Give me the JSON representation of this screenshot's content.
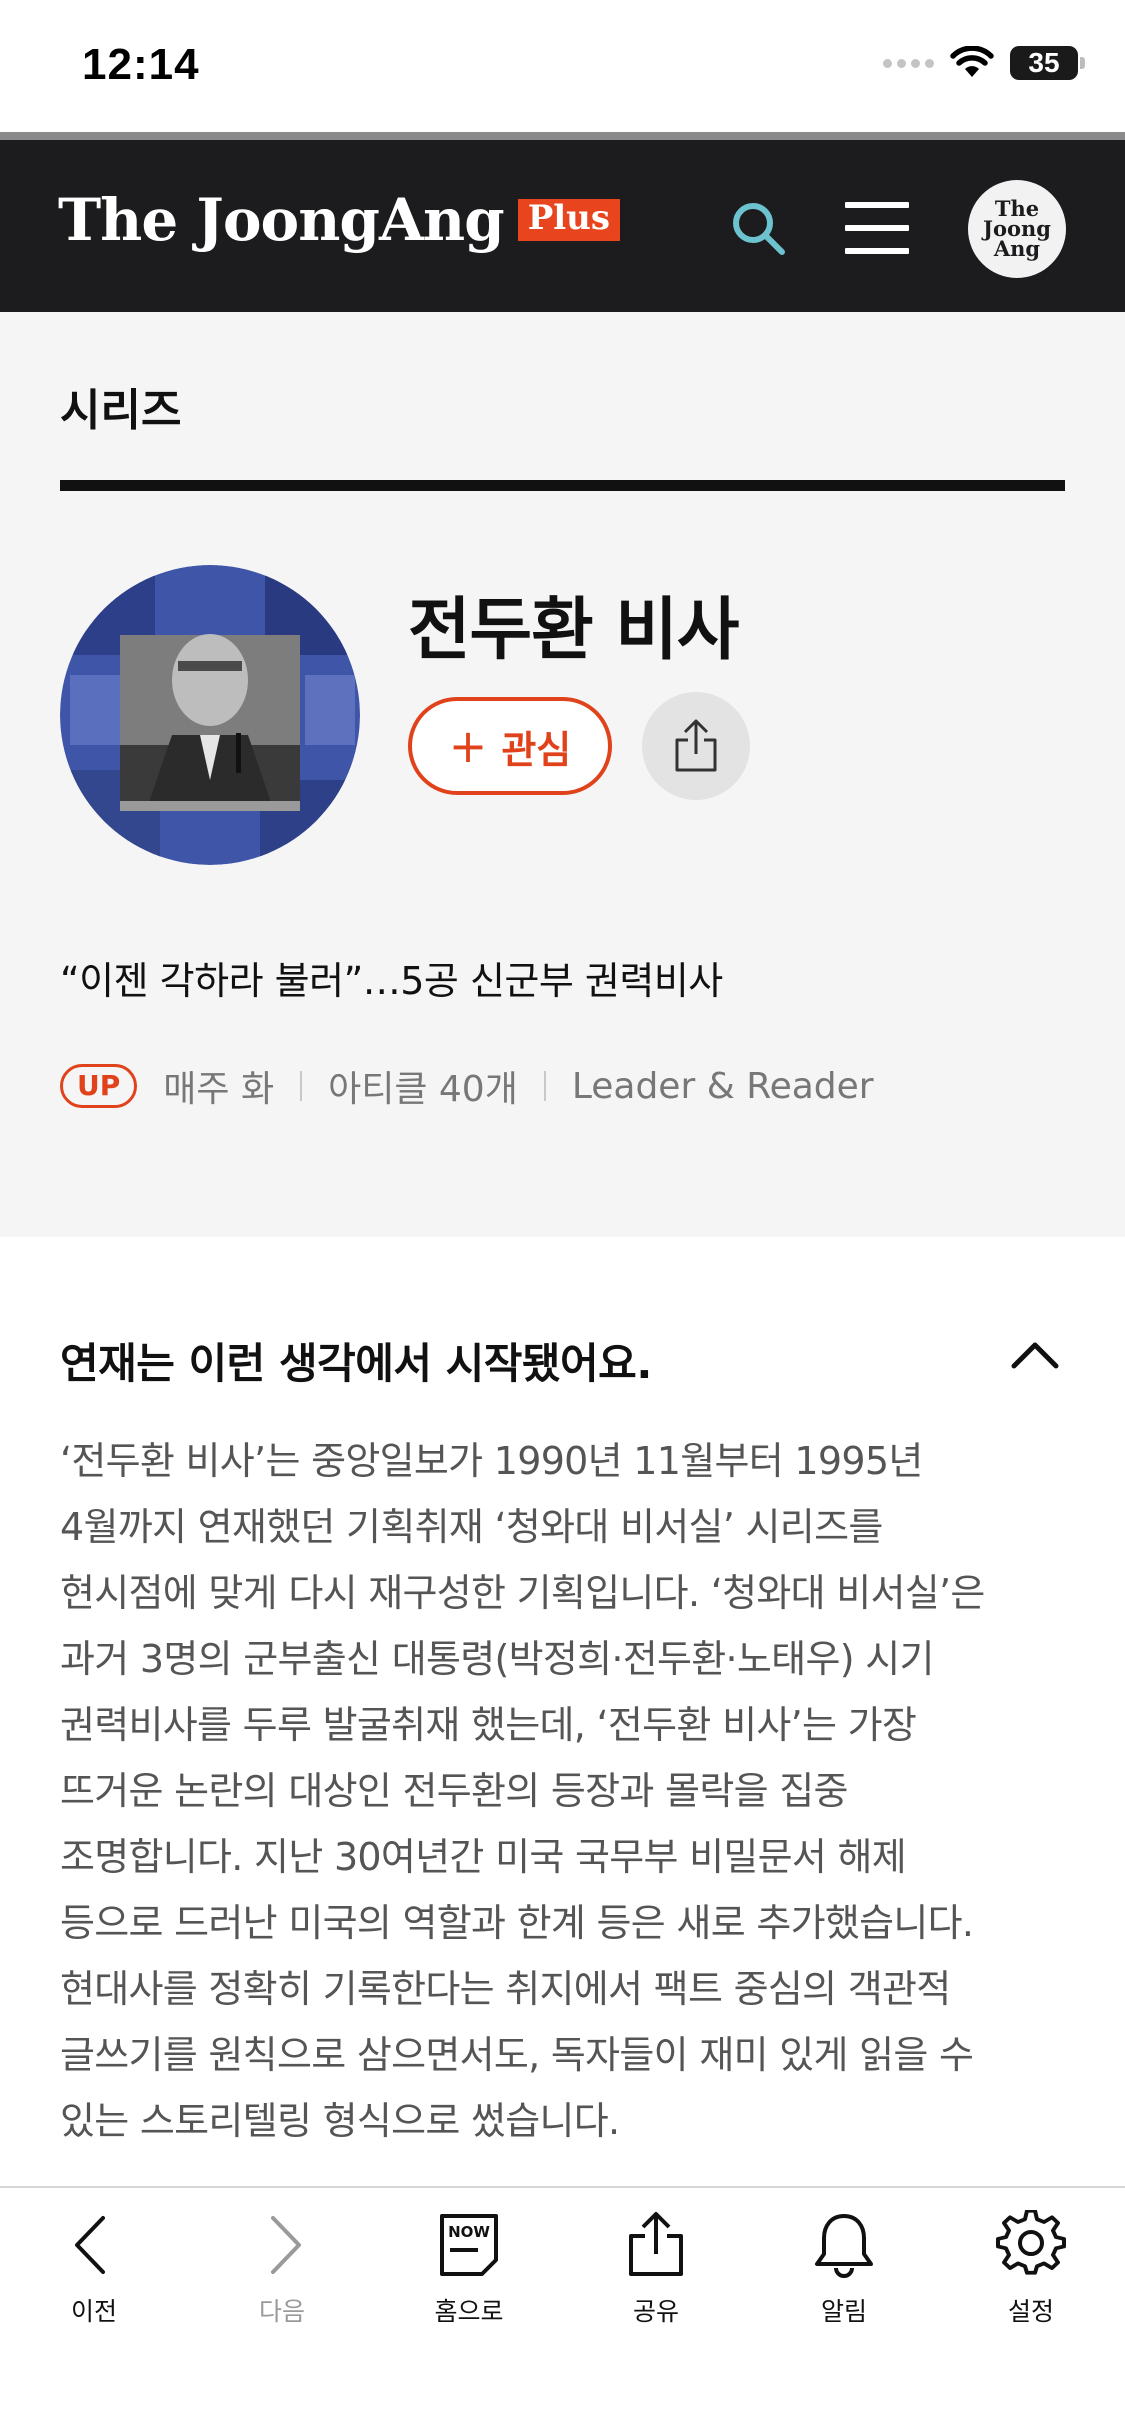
{
  "status_bar": {
    "time": "12:14",
    "battery": "35"
  },
  "header": {
    "logo": "The JoongAng",
    "logo_badge": "Plus",
    "avatar_text": "The Joong Ang",
    "icons": [
      "search-icon",
      "menu-icon",
      "avatar"
    ]
  },
  "series": {
    "section_label": "시리즈",
    "title": "전두환 비사",
    "follow_label": "관심",
    "subtitle": "“이젠 각하라 불러”…5공 신군부 권력비사",
    "badge": "UP",
    "schedule": "매주 화",
    "article_count": "아티클 40개",
    "section_name": "Leader & Reader"
  },
  "intro": {
    "heading": "연재는 이런 생각에서 시작됐어요.",
    "lines": [
      "‘전두환 비사’는 중앙일보가 1990년 11월부터 1995년",
      "4월까지 연재했던 기획취재 ‘청와대 비서실’ 시리즈를",
      "현시점에 맞게 다시 재구성한 기획입니다. ‘청와대 비서실’은",
      "과거 3명의 군부출신 대통령(박정희·전두환·노태우) 시기",
      "권력비사를 두루 발굴취재 했는데, ‘전두환 비사’는 가장",
      "뜨거운 논란의 대상인 전두환의 등장과 몰락을 집중",
      "조명합니다. 지난 30여년간 미국 국무부 비밀문서 해제",
      "등으로 드러난 미국의 역할과 한계 등은 새로 추가했습니다.",
      "현대사를 정확히 기록한다는 취지에서 팩트 중심의 객관적",
      "글쓰기를 원칙으로 삼으면서도, 독자들이 재미 있게 읽을 수",
      "있는 스토리텔링 형식으로 썼습니다."
    ]
  },
  "toolbar": {
    "back": "이전",
    "forward": "다음",
    "home": "홈으로",
    "home_icon_text": "NOW",
    "share": "공유",
    "alerts": "알림",
    "settings": "설정"
  },
  "colors": {
    "accent": "#e0421b",
    "header_bg": "#1c1c1e",
    "panel_bg": "#f5f5f5"
  }
}
